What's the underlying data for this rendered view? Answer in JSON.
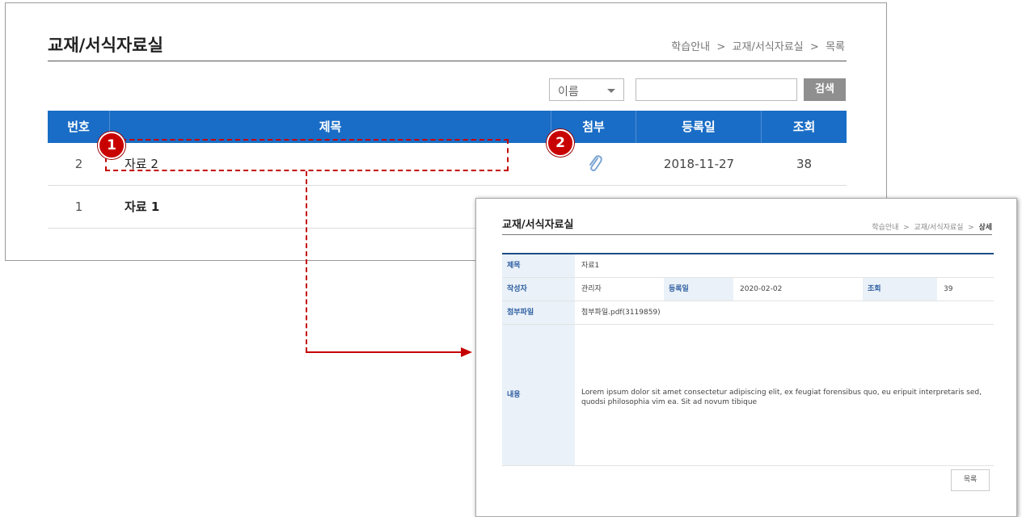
{
  "list_page": {
    "title": "교재/서식자료실",
    "breadcrumb": "학습안내  >  교재/서식자료실  >  목록",
    "search": {
      "field_option": "이름",
      "query": "",
      "button_label": "검색"
    },
    "columns": [
      "번호",
      "제목",
      "첨부",
      "등록일",
      "조회"
    ],
    "rows": [
      {
        "num": "2",
        "title": "자료 2",
        "attachment_icon": "paperclip-icon",
        "date": "2018-11-27",
        "views": "38"
      },
      {
        "num": "1",
        "title": "자료 1"
      }
    ]
  },
  "callouts": [
    {
      "label": "1",
      "color": "#c90000"
    },
    {
      "label": "2",
      "color": "#c90000"
    }
  ],
  "detail_page": {
    "title": "교재/서식자료실",
    "breadcrumb_prefix": "학습안내  >  교재/서식자료실  >  ",
    "breadcrumb_current": "상세",
    "fields": {
      "subject_label": "제목",
      "subject_value": "자료1",
      "author_label": "작성자",
      "author_value": "관리자",
      "date_label": "등록일",
      "date_value": "2020-02-02",
      "views_label": "조회",
      "views_value": "39",
      "file_label": "첨부파일",
      "file_value": "첨부파일.pdf(3119859)",
      "content_label": "내용",
      "content_value": "Lorem ipsum dolor sit amet consectetur adipiscing elit, ex feugiat forensibus quo, eu eripuit interpretaris sed, quodsi philosophia vim ea. Sit ad novum tibique"
    },
    "list_button_label": "목록"
  },
  "colors": {
    "header_blue": "#1a6dc6",
    "accent_red": "#c40000",
    "label_bg": "#eaf1f8",
    "label_text": "#2c5da0"
  }
}
